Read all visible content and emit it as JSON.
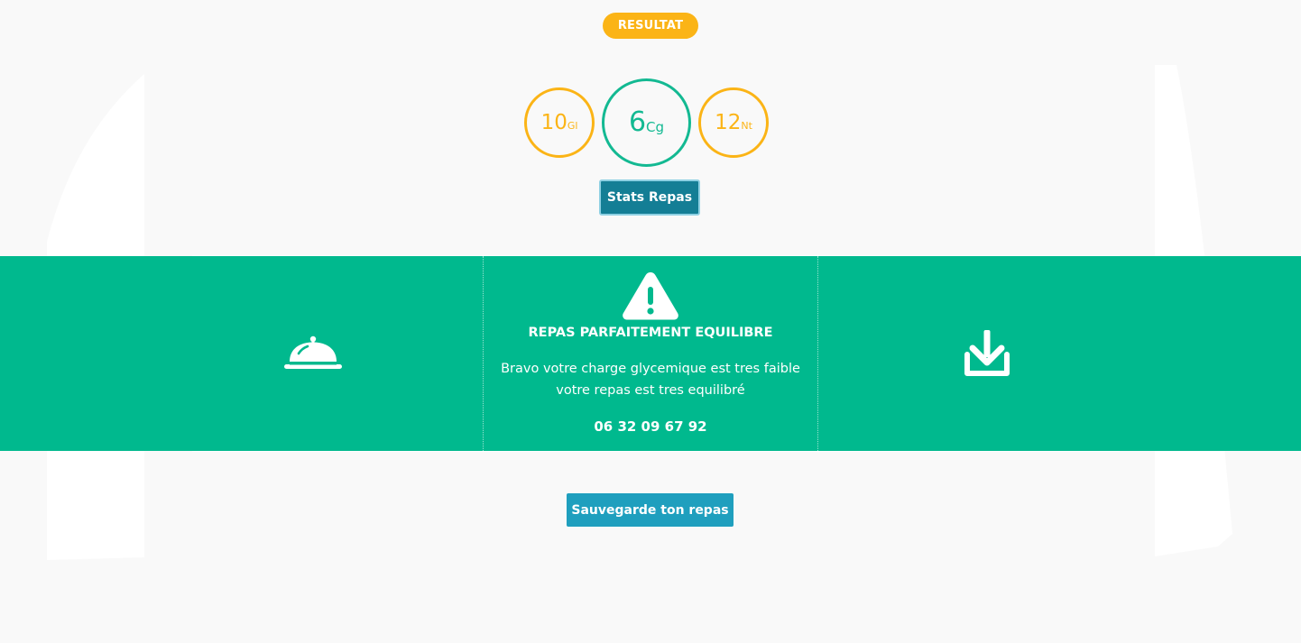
{
  "result": {
    "badge_label": "RESULTAT"
  },
  "scores": {
    "gi": {
      "value": "10",
      "unit": "Gl"
    },
    "cg": {
      "value": "6",
      "unit": "Cg"
    },
    "nt": {
      "value": "12",
      "unit": "Nt"
    }
  },
  "stats_button_label": "Stats Repas",
  "panel": {
    "title": "REPAS PARFAITEMENT EQUILIBRE",
    "message_line1": "Bravo votre charge glycemique est tres faible",
    "message_line2": "votre repas est tres equilibré",
    "phone": "06 32 09 67 92"
  },
  "icons": {
    "left": "dish-cloche-icon",
    "center": "warning-triangle-icon",
    "right": "download-icon"
  },
  "save_button_label": "Sauvegarde ton repas",
  "colors": {
    "accent_orange": "#fbb416",
    "accent_green": "#00b98e",
    "button_teal": "#147e95",
    "button_blue": "#1f9fbe"
  }
}
